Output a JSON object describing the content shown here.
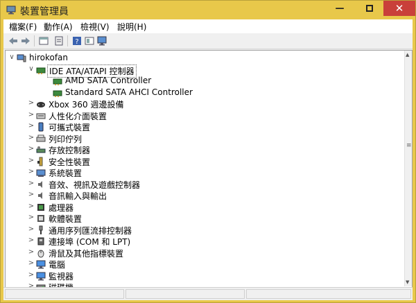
{
  "window": {
    "title": "裝置管理員",
    "minimize_glyph": "—",
    "maximize_glyph": "▫",
    "close_glyph": "✕"
  },
  "menu": [
    {
      "label": "檔案(F)"
    },
    {
      "label": "動作(A)"
    },
    {
      "label": "檢視(V)"
    },
    {
      "label": "說明(H)"
    }
  ],
  "toolbar": {
    "icons": [
      "back-arrow-icon",
      "forward-arrow-icon",
      "properties-icon",
      "scan-icon",
      "help-icon",
      "show-hidden-icon",
      "monitor-icon"
    ]
  },
  "tree": {
    "root": {
      "label": "hirokofan",
      "expander": "∨",
      "icon": "computer-icon"
    },
    "items": [
      {
        "label": "IDE ATA/ATAPI 控制器",
        "level": 1,
        "expander": "∨",
        "icon": "ide-controller-icon",
        "selected": true
      },
      {
        "label": "AMD SATA Controller",
        "level": 2,
        "expander": "",
        "icon": "ide-controller-icon"
      },
      {
        "label": "Standard SATA AHCI Controller",
        "level": 2,
        "expander": "",
        "icon": "ide-controller-icon"
      },
      {
        "label": "Xbox 360 週邊設備",
        "level": 1,
        "expander": ">",
        "icon": "gamepad-icon"
      },
      {
        "label": "人性化介面裝置",
        "level": 1,
        "expander": ">",
        "icon": "keyboard-icon"
      },
      {
        "label": "可攜式裝置",
        "level": 1,
        "expander": ">",
        "icon": "portable-device-icon"
      },
      {
        "label": "列印佇列",
        "level": 1,
        "expander": ">",
        "icon": "printer-icon"
      },
      {
        "label": "存放控制器",
        "level": 1,
        "expander": ">",
        "icon": "storage-controller-icon"
      },
      {
        "label": "安全性裝置",
        "level": 1,
        "expander": ">",
        "icon": "security-key-icon"
      },
      {
        "label": "系統裝置",
        "level": 1,
        "expander": ">",
        "icon": "system-device-icon"
      },
      {
        "label": "音效、視訊及遊戲控制器",
        "level": 1,
        "expander": ">",
        "icon": "speaker-icon"
      },
      {
        "label": "音訊輸入與輸出",
        "level": 1,
        "expander": ">",
        "icon": "speaker-icon"
      },
      {
        "label": "處理器",
        "level": 1,
        "expander": ">",
        "icon": "processor-icon"
      },
      {
        "label": "軟體裝置",
        "level": 1,
        "expander": ">",
        "icon": "software-device-icon"
      },
      {
        "label": "通用序列匯流排控制器",
        "level": 1,
        "expander": ">",
        "icon": "usb-icon"
      },
      {
        "label": "連接埠 (COM 和 LPT)",
        "level": 1,
        "expander": ">",
        "icon": "port-icon"
      },
      {
        "label": "滑鼠及其他指標裝置",
        "level": 1,
        "expander": ">",
        "icon": "mouse-icon"
      },
      {
        "label": "電腦",
        "level": 1,
        "expander": ">",
        "icon": "monitor-icon"
      },
      {
        "label": "監視器",
        "level": 1,
        "expander": ">",
        "icon": "monitor-icon"
      },
      {
        "label": "磁碟機",
        "level": 1,
        "expander": ">",
        "icon": "disk-drive-icon"
      }
    ]
  },
  "colors": {
    "titlebar": "#e8c84a",
    "close_button": "#c9403a"
  }
}
